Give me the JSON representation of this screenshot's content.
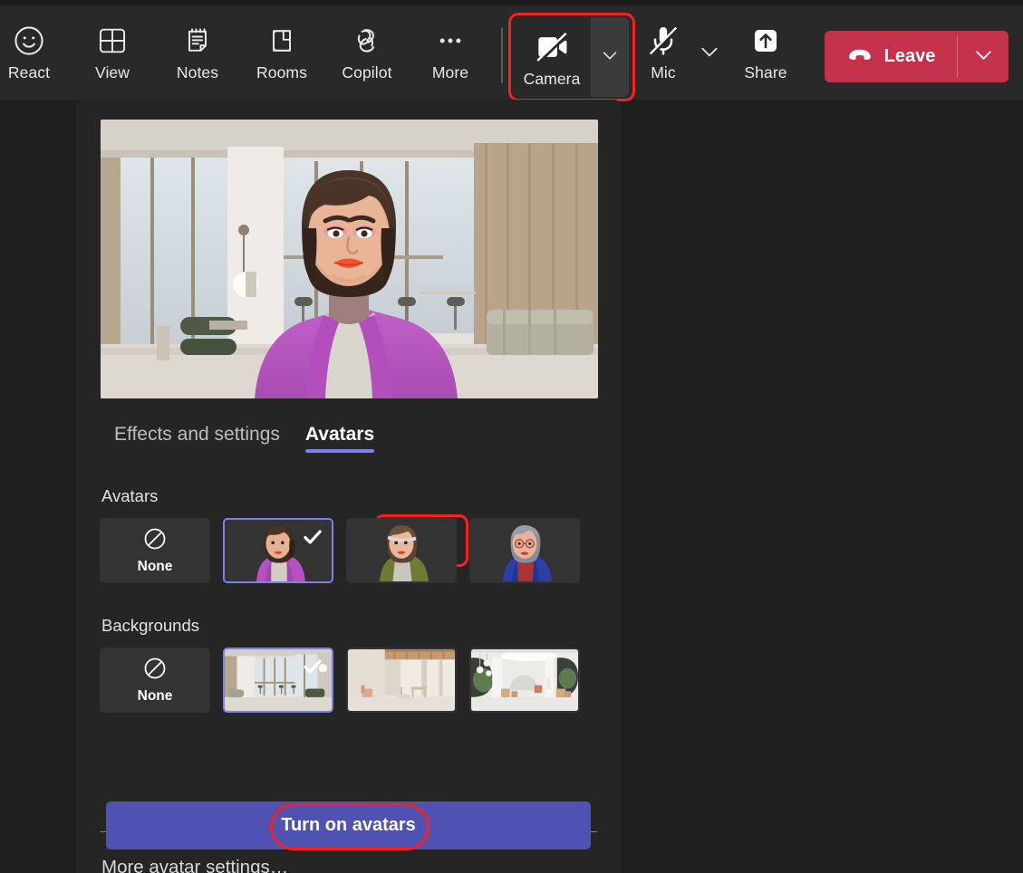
{
  "toolbar": {
    "items": [
      {
        "label": "React",
        "icon": "smiley-icon"
      },
      {
        "label": "View",
        "icon": "grid-icon"
      },
      {
        "label": "Notes",
        "icon": "notes-icon"
      },
      {
        "label": "Rooms",
        "icon": "rooms-icon"
      },
      {
        "label": "Copilot",
        "icon": "copilot-icon"
      },
      {
        "label": "More",
        "icon": "ellipsis-icon"
      }
    ],
    "camera": {
      "label": "Camera",
      "icon": "camera-off-icon",
      "caret_icon": "chevron-down-icon",
      "highlighted": true
    },
    "mic": {
      "label": "Mic",
      "icon": "mic-off-icon",
      "caret_icon": "chevron-down-icon"
    },
    "share": {
      "label": "Share",
      "icon": "share-up-arrow-icon"
    },
    "leave": {
      "label": "Leave",
      "icon": "hangup-phone-icon",
      "caret_icon": "chevron-down-icon",
      "color": "#c4314b"
    }
  },
  "panel": {
    "preview_alt": "avatar-video-preview",
    "tabs": [
      {
        "label": "Effects and settings",
        "active": false
      },
      {
        "label": "Avatars",
        "active": true,
        "highlighted": true
      }
    ],
    "avatars": {
      "section_label": "Avatars",
      "items": [
        {
          "label": "None",
          "type": "none",
          "selected": false
        },
        {
          "label": "",
          "type": "avatar-purple-cardigan",
          "selected": true
        },
        {
          "label": "",
          "type": "avatar-olive-top",
          "selected": false
        },
        {
          "label": "",
          "type": "avatar-blue-blazer-glasses",
          "selected": false
        }
      ]
    },
    "backgrounds": {
      "section_label": "Backgrounds",
      "items": [
        {
          "label": "None",
          "type": "none",
          "selected": false
        },
        {
          "label": "",
          "type": "bg-modern-loft-windows",
          "selected": true
        },
        {
          "label": "",
          "type": "bg-wood-beam-room",
          "selected": false
        },
        {
          "label": "",
          "type": "bg-white-atrium",
          "selected": false
        }
      ]
    },
    "more_settings_label": "More avatar settings…",
    "primary_button": {
      "label": "Turn on avatars",
      "color": "#4f52b2",
      "highlighted": true
    }
  },
  "colors": {
    "accent_purple": "#7b83eb",
    "button_purple": "#4f52b2",
    "leave_red": "#c4314b",
    "highlight_red": "#f4211f",
    "panel_bg": "#252525",
    "toolbar_bg": "#292929"
  }
}
